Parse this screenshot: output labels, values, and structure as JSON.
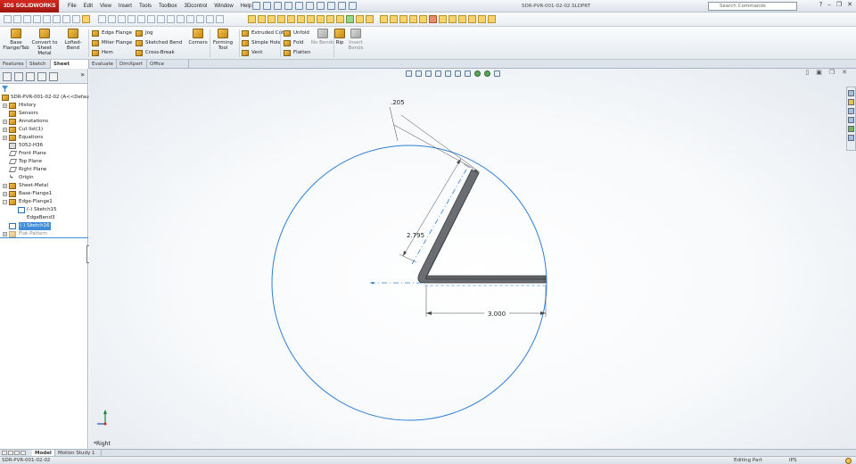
{
  "app": {
    "logo_text": "SOLIDWORKS",
    "logo_mark": "3DS",
    "document_title": "SDR-PVR-001-02-02.SLDPRT",
    "search_placeholder": "Search Commands",
    "search_icon": "search-icon"
  },
  "menu": [
    "File",
    "Edit",
    "View",
    "Insert",
    "Tools",
    "Toolbox",
    "3Dcontrol",
    "Window",
    "Help"
  ],
  "command_manager": {
    "base_flange_tab": "Base Flange/Tab",
    "convert_to_sheet_metal": "Convert to Sheet Metal",
    "lofted_bend": "Lofted-Bend",
    "edge_flange": "Edge Flange",
    "miter_flange": "Miter Flange",
    "hem": "Hem",
    "jog": "Jog",
    "sketched_bend": "Sketched Bend",
    "cross_break": "Cross-Break",
    "corners": "Corners",
    "forming_tool": "Forming Tool",
    "extruded_cut": "Extruded Cut",
    "simple_hole": "Simple Hole",
    "vent": "Vent",
    "unfold": "Unfold",
    "fold": "Fold",
    "flatten": "Flatten",
    "no_bends": "No Bends",
    "rip": "Rip",
    "insert_bends": "Insert Bends"
  },
  "tabs": [
    "Features",
    "Sketch",
    "Sheet Metal",
    "Evaluate",
    "DimXpert",
    "Office Products"
  ],
  "active_tab": "Sheet Metal",
  "tree": {
    "root": "SDR-PVR-001-02-02  (A<<Default",
    "items": [
      {
        "label": "History"
      },
      {
        "label": "Sensors"
      },
      {
        "label": "Annotations"
      },
      {
        "label": "Cut list(1)"
      },
      {
        "label": "Equations"
      },
      {
        "label": "5052-H36"
      },
      {
        "label": "Front Plane"
      },
      {
        "label": "Top Plane"
      },
      {
        "label": "Right Plane"
      },
      {
        "label": "Origin"
      },
      {
        "label": "Sheet-Metal"
      },
      {
        "label": "Base-Flange1"
      },
      {
        "label": "Edge-Flange1"
      },
      {
        "label": "(-) Sketch15"
      },
      {
        "label": "EdgeBend3"
      },
      {
        "label": "(-) Sketch16"
      },
      {
        "label": "Flat-Pattern"
      }
    ]
  },
  "graphics": {
    "view_label": "*Right",
    "dimensions": {
      "thickness": ".205",
      "flange_length": "2.795",
      "base_length": "3.000"
    },
    "colors": {
      "sketch_blue": "#2f7fd3",
      "part_gray": "#5f6266",
      "dimension_gray": "#444444"
    }
  },
  "model_tabs": [
    "Model",
    "Motion Study 1"
  ],
  "active_model_tab": "Model",
  "status": {
    "file": "SDR-PVR-001-02-02",
    "mode": "Editing Part",
    "units": "IPS"
  }
}
